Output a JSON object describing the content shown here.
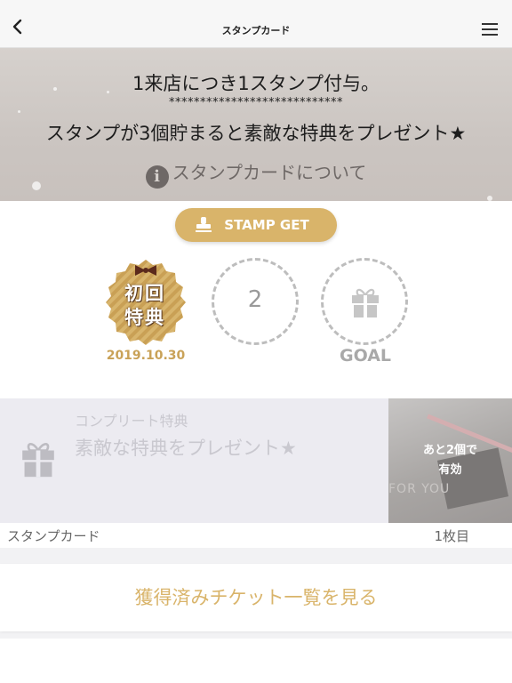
{
  "nav": {
    "title": "スタンプカード",
    "back_icon": "chevron-left-icon",
    "menu_icon": "hamburger-menu-icon"
  },
  "hero": {
    "line1": "1来店につき1スタンプ付与。",
    "line2": "****************************",
    "line3": "スタンプが3個貯まると素敵な特典をプレゼント★",
    "about_icon": "i",
    "about_label": "スタンプカードについて"
  },
  "stamp_button": {
    "label": "STAMP GET",
    "icon": "stamp-icon"
  },
  "stamps": {
    "slot1": {
      "badge_line1": "初回",
      "badge_line2": "特典",
      "date": "2019.10.30"
    },
    "slot2": {
      "number": "2"
    },
    "slot3": {
      "label": "GOAL",
      "icon": "gift-icon"
    }
  },
  "complete": {
    "label": "コンプリート特典",
    "title": "素敵な特典をプレゼント★",
    "image_text": "FOR YOU",
    "remain_line1": "あと2個で",
    "remain_line2": "有効"
  },
  "card_footer": {
    "left": "スタンプカード",
    "right": "1枚目"
  },
  "tickets_button": {
    "label": "獲得済みチケット一覧を見る"
  },
  "colors": {
    "accent_gold": "#d9b46a",
    "hero_bg": "#d6d1cd",
    "complete_bg": "#ecebf1"
  }
}
